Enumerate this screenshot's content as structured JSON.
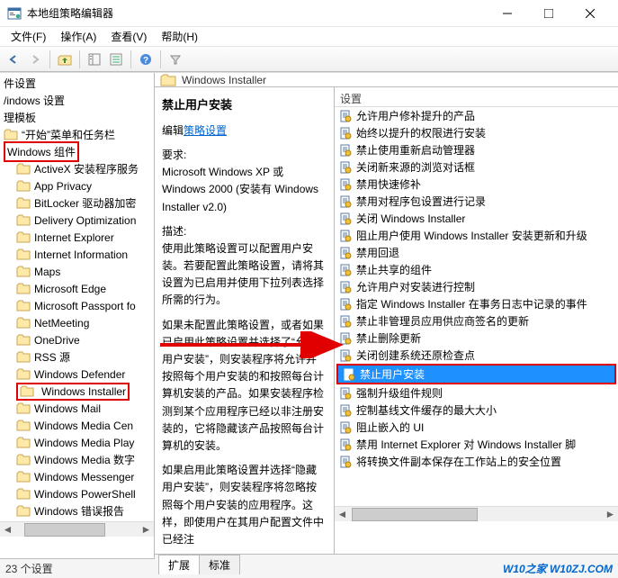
{
  "window": {
    "title": "本地组策略编辑器"
  },
  "menu": {
    "file": "文件(F)",
    "action": "操作(A)",
    "view": "查看(V)",
    "help": "帮助(H)"
  },
  "tree": {
    "header1": "件设置",
    "header2": "/indows 设置",
    "header3": "理模板",
    "item_start": "“开始”菜单和任务栏",
    "group_win_components": "Windows 组件",
    "items": [
      "ActiveX 安装程序服务",
      "App Privacy",
      "BitLocker 驱动器加密",
      "Delivery Optimization",
      "Internet Explorer",
      "Internet Information",
      "Maps",
      "Microsoft Edge",
      "Microsoft Passport fo",
      "NetMeeting",
      "OneDrive",
      "RSS 源",
      "Windows Defender",
      "Windows Installer",
      "Windows Mail",
      "Windows Media Cen",
      "Windows Media Play",
      "Windows Media 数字",
      "Windows Messenger",
      "Windows PowerShell",
      "Windows 错误报告"
    ]
  },
  "path": {
    "label": "Windows Installer"
  },
  "desc": {
    "title": "禁止用户安装",
    "edit_label": "编辑",
    "policy_setting": "策略设置",
    "req_label": "要求:",
    "req_body": "Microsoft Windows XP 或 Windows 2000 (安装有 Windows Installer v2.0)",
    "desc_label": "描述:",
    "desc_body1": "使用此策略设置可以配置用户安装。若要配置此策略设置，请将其设置为已启用并使用下拉列表选择所需的行为。",
    "desc_body2": "如果未配置此策略设置，或者如果已启用此策略设置并选择了“允许用户安装”，则安装程序将允许并按照每个用户安装的和按照每台计算机安装的产品。如果安装程序检测到某个应用程序已经以非注册安装的，它将隐藏该产品按照每台计算机的安装。",
    "desc_body3": "如果启用此策略设置并选择“隐藏用户安装”，则安装程序将忽略按照每个用户安装的应用程序。这样，即使用户在其用户配置文件中已经注"
  },
  "settings": {
    "header": "设置",
    "items": [
      {
        "label": "允许用户修补提升的产品",
        "sel": false
      },
      {
        "label": "始终以提升的权限进行安装",
        "sel": false
      },
      {
        "label": "禁止使用重新启动管理器",
        "sel": false
      },
      {
        "label": "关闭新来源的浏览对话框",
        "sel": false
      },
      {
        "label": "禁用快速修补",
        "sel": false
      },
      {
        "label": "禁用对程序包设置进行记录",
        "sel": false
      },
      {
        "label": "关闭 Windows Installer",
        "sel": false
      },
      {
        "label": "阻止用户使用 Windows Installer 安装更新和升级",
        "sel": false
      },
      {
        "label": "禁用回退",
        "sel": false
      },
      {
        "label": "禁止共享的组件",
        "sel": false
      },
      {
        "label": "允许用户对安装进行控制",
        "sel": false
      },
      {
        "label": "指定 Windows Installer 在事务日志中记录的事件",
        "sel": false
      },
      {
        "label": "禁止非管理员应用供应商签名的更新",
        "sel": false
      },
      {
        "label": "禁止删除更新",
        "sel": false
      },
      {
        "label": "关闭创建系统还原检查点",
        "sel": false
      },
      {
        "label": "禁止用户安装",
        "sel": true
      },
      {
        "label": "强制升级组件规则",
        "sel": false
      },
      {
        "label": "控制基线文件缓存的最大大小",
        "sel": false
      },
      {
        "label": "阻止嵌入的 UI",
        "sel": false
      },
      {
        "label": "禁用 Internet Explorer 对 Windows Installer 脚",
        "sel": false
      },
      {
        "label": "将转换文件副本保存在工作站上的安全位置",
        "sel": false
      }
    ]
  },
  "tabs": {
    "extended": "扩展",
    "standard": "标准"
  },
  "status": {
    "count": "23 个设置",
    "brand": "W10之家 W10ZJ.COM"
  }
}
